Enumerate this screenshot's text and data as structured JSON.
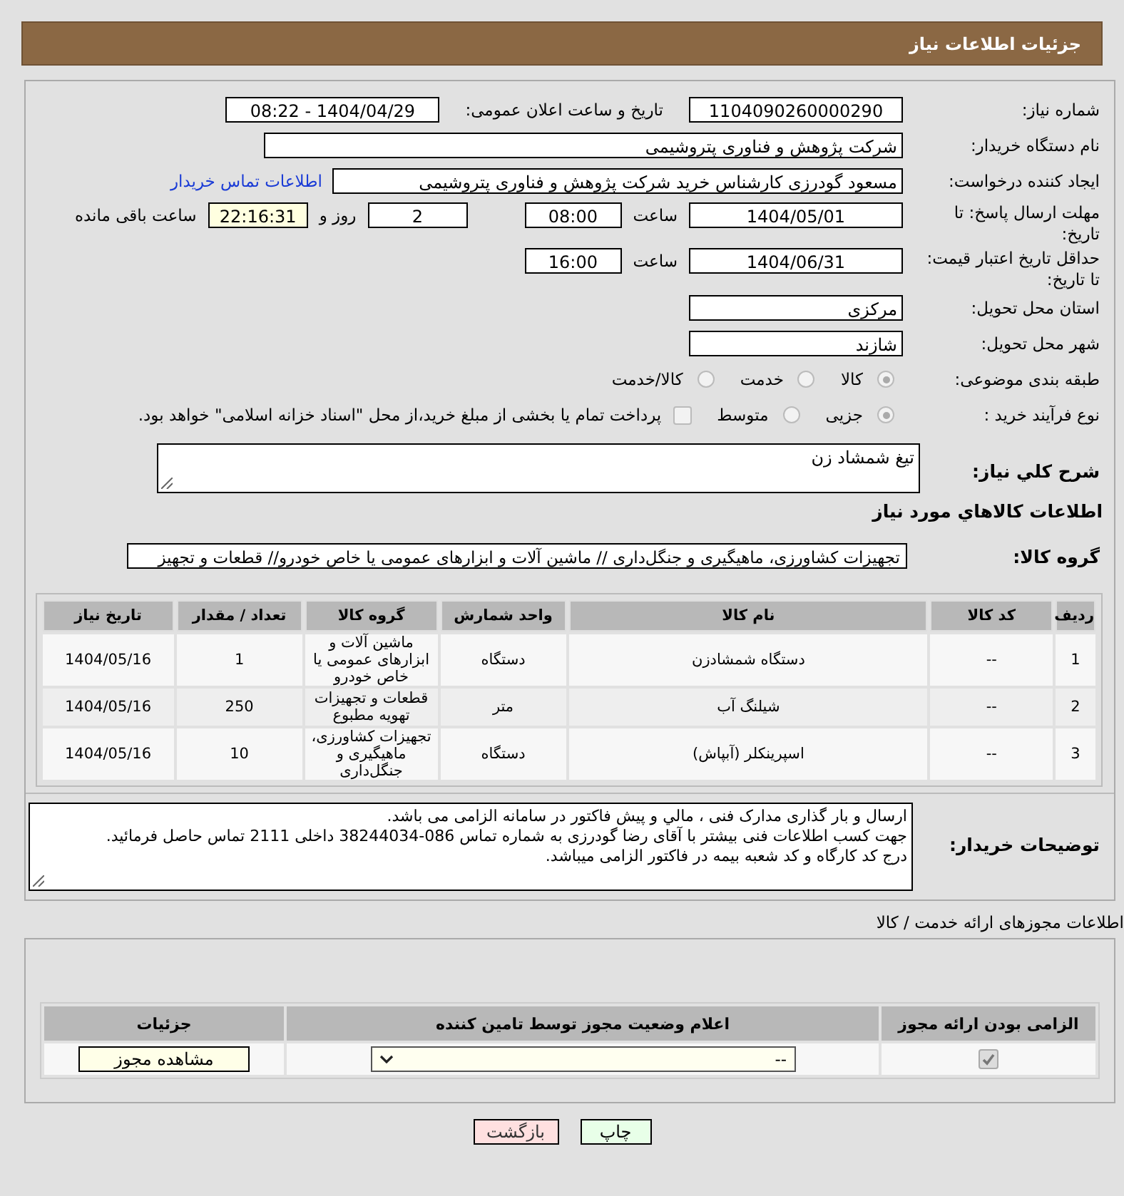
{
  "header": {
    "title": "جزئیات اطلاعات نیاز"
  },
  "need_number": {
    "label": "شماره نیاز:",
    "value": "1104090260000290"
  },
  "announce": {
    "label": "تاریخ و ساعت اعلان عمومی:",
    "value": "1404/04/29 - 08:22"
  },
  "buyer_org": {
    "label": "نام دستگاه خریدار:",
    "value": "شرکت پژوهش و فناوری پتروشیمی"
  },
  "requester": {
    "label": "ایجاد کننده درخواست:",
    "value": "مسعود گودرزی کارشناس خرید شرکت پژوهش و فناوری پتروشیمی",
    "link": "اطلاعات تماس خریدار"
  },
  "deadline": {
    "label": "مهلت ارسال پاسخ: تا تاریخ:",
    "date": "1404/05/01",
    "time_label": "ساعت",
    "time": "08:00",
    "days": "2",
    "days_label": "روز و",
    "remaining": "22:16:31",
    "remaining_label": "ساعت باقی مانده"
  },
  "price_validity": {
    "label": "حداقل تاریخ اعتبار قیمت: تا تاریخ:",
    "date": "1404/06/31",
    "time_label": "ساعت",
    "time": "16:00"
  },
  "province": {
    "label": "استان محل تحویل:",
    "value": "مرکزی"
  },
  "city": {
    "label": "شهر محل تحویل:",
    "value": "شازند"
  },
  "category": {
    "label": "طبقه بندی موضوعی:",
    "options": [
      {
        "label": "کالا",
        "selected": true
      },
      {
        "label": "خدمت",
        "selected": false
      },
      {
        "label": "کالا/خدمت",
        "selected": false
      }
    ]
  },
  "process": {
    "label": "نوع فرآیند خرید :",
    "options": [
      {
        "label": "جزیی",
        "selected": true
      },
      {
        "label": "متوسط",
        "selected": false
      }
    ],
    "treasury": {
      "label": "پرداخت تمام یا بخشی از مبلغ خرید،از محل \"اسناد خزانه اسلامی\" خواهد بود.",
      "checked": false
    }
  },
  "description": {
    "label": "شرح کلي نياز:",
    "value": "تیغ شمشاد زن"
  },
  "goods": {
    "title": "اطلاعات کالاهاي مورد نياز",
    "group_label": "گروه کالا:",
    "group_value": "تجهیزات کشاورزی، ماهیگیری و جنگل‌داری //  ماشین آلات و ابزارهای عمومی یا خاص خودرو//  قطعات و تجهیز"
  },
  "table": {
    "columns": [
      "ردیف",
      "کد کالا",
      "نام کالا",
      "واحد شمارش",
      "گروه کالا",
      "تعداد / مقدار",
      "تاریخ نیاز"
    ],
    "rows": [
      [
        "1",
        "--",
        "دستگاه شمشادزن",
        "دستگاه",
        "ماشین آلات و ابزارهای عمومی یا خاص خودرو",
        "1",
        "1404/05/16"
      ],
      [
        "2",
        "--",
        "شیلنگ آب",
        "متر",
        "قطعات و تجهیزات تهویه مطبوع",
        "250",
        "1404/05/16"
      ],
      [
        "3",
        "--",
        "اسپرینکلر (آبپاش)",
        "دستگاه",
        "تجهیزات کشاورزی، ماهیگیری و جنگل‌داری",
        "10",
        "1404/05/16"
      ]
    ]
  },
  "buyer_notes": {
    "label": "توضیحات خریدار:",
    "lines": [
      "ارسال و بار گذاری مدارک فنی ، مالي و پیش فاکتور در سامانه الزامی می باشد.",
      "جهت کسب اطلاعات فنی بیشتر با آقای رضا گودرزی به شماره تماس 086-38244034 داخلی 2111 تماس حاصل فرمائید.",
      "درج کد کارگاه و کد شعبه بیمه  در فاکتور الزامی میباشد."
    ]
  },
  "permits": {
    "title": "اطلاعات مجوزهای ارائه خدمت / کالا",
    "columns": [
      "الزامی بودن ارائه مجوز",
      "اعلام وضعیت مجوز توسط تامین کننده",
      "جزئیات"
    ],
    "rows": [
      {
        "required": true,
        "status": "--",
        "button": "مشاهده مجوز"
      }
    ]
  },
  "buttons": [
    {
      "kind": "print",
      "label": "چاپ"
    },
    {
      "kind": "back",
      "label": "بازگشت"
    }
  ]
}
